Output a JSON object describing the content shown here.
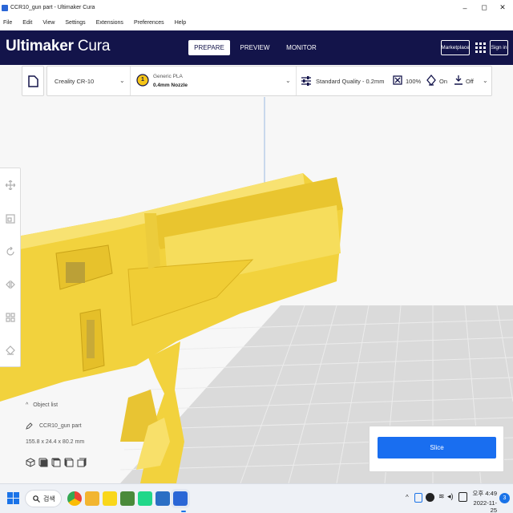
{
  "window": {
    "title": "CCR10_gun part - Ultimaker Cura",
    "controls": [
      "–",
      "◻",
      "✕"
    ]
  },
  "menu": [
    "File",
    "Edit",
    "View",
    "Settings",
    "Extensions",
    "Preferences",
    "Help"
  ],
  "header": {
    "brand_bold": "Ultimaker",
    "brand_light": " Cura",
    "tabs": [
      "PREPARE",
      "PREVIEW",
      "MONITOR"
    ],
    "active_tab": "PREPARE",
    "marketplace": "Marketplace",
    "signin": "Sign in"
  },
  "toolbar": {
    "printer": "Creality CR-10",
    "material_brand": "Generic PLA",
    "nozzle": "0.4mm Nozzle",
    "extruder_number": "1",
    "quality": "Standard Quality - 0.2mm",
    "infill": "100%",
    "support": "On",
    "adhesion": "Off"
  },
  "tools": [
    "move-icon",
    "scale-icon",
    "rotate-icon",
    "mirror-icon",
    "per-model-settings-icon",
    "support-blocker-icon"
  ],
  "object_list": {
    "header": "Object list",
    "object_name": "CCR10_gun part",
    "dimensions": "155.8 x 24.4 x 80.2 mm"
  },
  "slice_panel": {
    "button": "Slice"
  },
  "taskbar": {
    "search": "검색",
    "time": "오후 4:49",
    "date": "2022-11-25",
    "notification_count": "3"
  },
  "colors": {
    "header_bg": "#13144a",
    "accent": "#196ef0",
    "model": "#f5d84a"
  }
}
